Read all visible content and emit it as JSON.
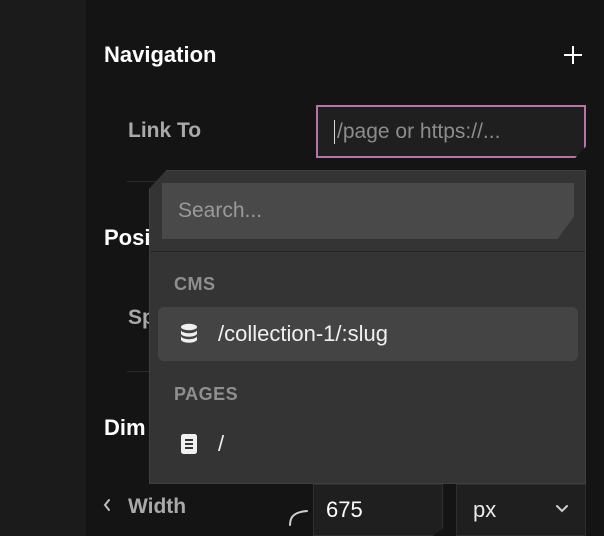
{
  "navigation": {
    "title": "Navigation",
    "link_to_label": "Link To",
    "link_placeholder": "/page or https://..."
  },
  "position": {
    "title_visible": "Posi",
    "sub_label_visible": "Sp"
  },
  "dimensions": {
    "title_visible": "Dim",
    "width_label": "Width",
    "width_value": "675",
    "unit": "px"
  },
  "dropdown": {
    "search_placeholder": "Search...",
    "groups": [
      {
        "label": "CMS",
        "items": [
          {
            "icon": "database-icon",
            "text": "/collection-1/:slug"
          }
        ]
      },
      {
        "label": "PAGES",
        "items": [
          {
            "icon": "page-icon",
            "text": "/"
          }
        ]
      }
    ]
  },
  "colors": {
    "accent_border": "#b774a7",
    "panel_bg": "#141414",
    "dropdown_bg": "#343434"
  }
}
